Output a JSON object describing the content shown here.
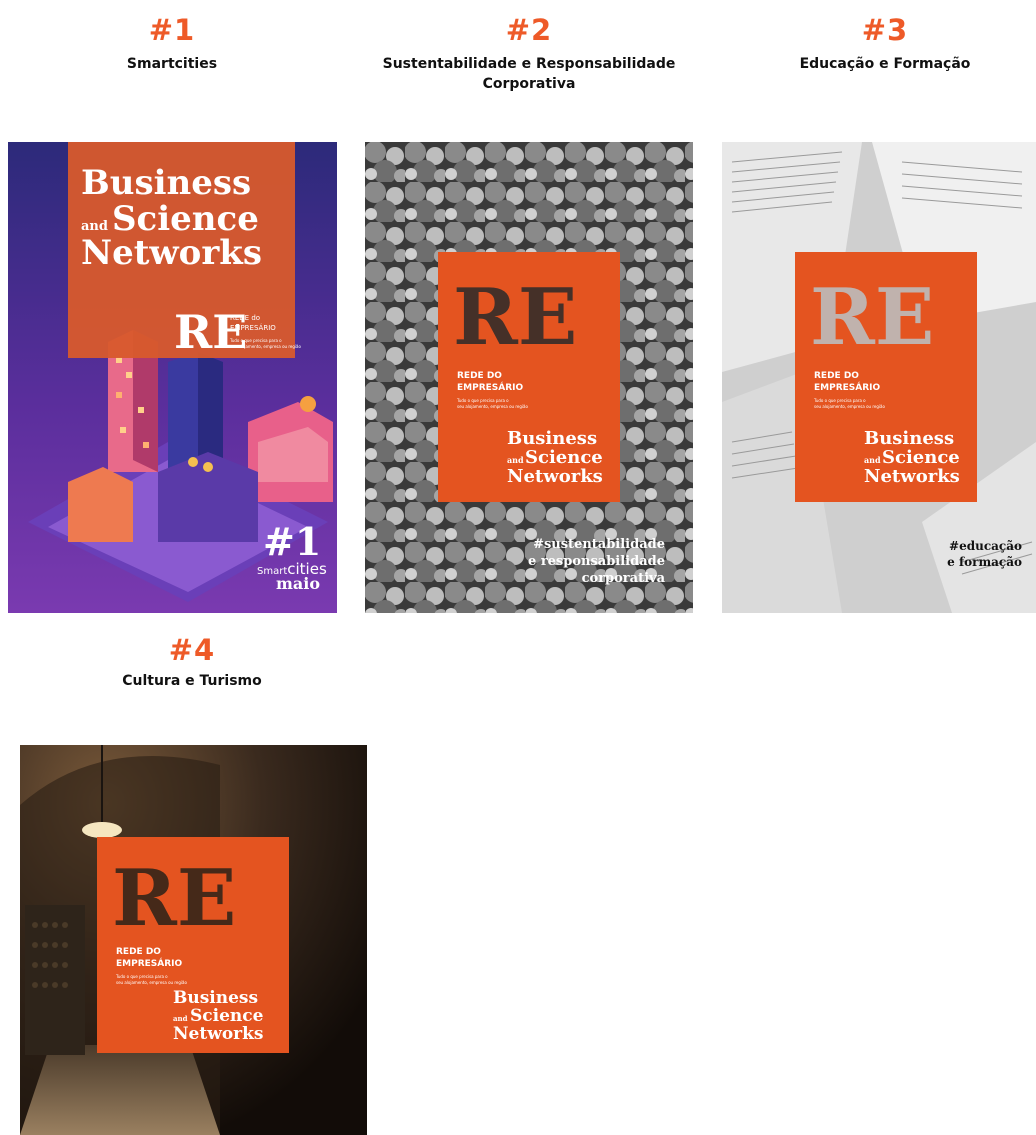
{
  "issues": [
    {
      "number": "#1",
      "title": "Smartcities",
      "cover": {
        "brand_line1": "Business",
        "brand_and": "and",
        "brand_line2": "Science",
        "brand_line3": "Networks",
        "logo": "RE",
        "logo_sub1": "REDE do",
        "logo_sub2": "EMPRESÁRIO",
        "tagline1": "Tudo o que precisa para o",
        "tagline2": "seu alojamento, empresa ou região",
        "issue_mark": "#1",
        "theme_smart": "Smart",
        "theme_cities": "cities",
        "month": "maio"
      }
    },
    {
      "number": "#2",
      "title": "Sustentabilidade e Responsabilidade Corporativa",
      "title_line1": "Sustentabilidade e Responsabilidade",
      "title_line2": "Corporativa",
      "cover": {
        "logo": "RE",
        "logo_sub1": "REDE DO",
        "logo_sub2": "EMPRESÁRIO",
        "tagline1": "Tudo o que precisa para o",
        "tagline2": "seu alojamento, empresa ou região",
        "brand_line1": "Business",
        "brand_and": "and",
        "brand_line2": "Science",
        "brand_line3": "Networks",
        "hashtag1": "#sustentabilidade",
        "hashtag2": "e responsabilidade",
        "hashtag3": "corporativa"
      }
    },
    {
      "number": "#3",
      "title": "Educação e Formação",
      "cover": {
        "logo": "RE",
        "logo_sub1": "REDE DO",
        "logo_sub2": "EMPRESÁRIO",
        "tagline1": "Tudo o que precisa para o",
        "tagline2": "seu alojamento, empresa ou região",
        "brand_line1": "Business",
        "brand_and": "and",
        "brand_line2": "Science",
        "brand_line3": "Networks",
        "hashtag1": "#educação",
        "hashtag2": "e formação"
      }
    },
    {
      "number": "#4",
      "title": "Cultura e Turismo",
      "cover": {
        "logo": "RE",
        "logo_sub1": "REDE DO",
        "logo_sub2": "EMPRESÁRIO",
        "tagline1": "Tudo o que precisa para o",
        "tagline2": "seu alojamento, empresa ou região",
        "brand_line1": "Business",
        "brand_and": "and",
        "brand_line2": "Science",
        "brand_line3": "Networks"
      }
    }
  ],
  "colors": {
    "accent": "#ee5a28",
    "cover_orange": "#e45420",
    "smartcities_bg": "#4a2a8c"
  }
}
